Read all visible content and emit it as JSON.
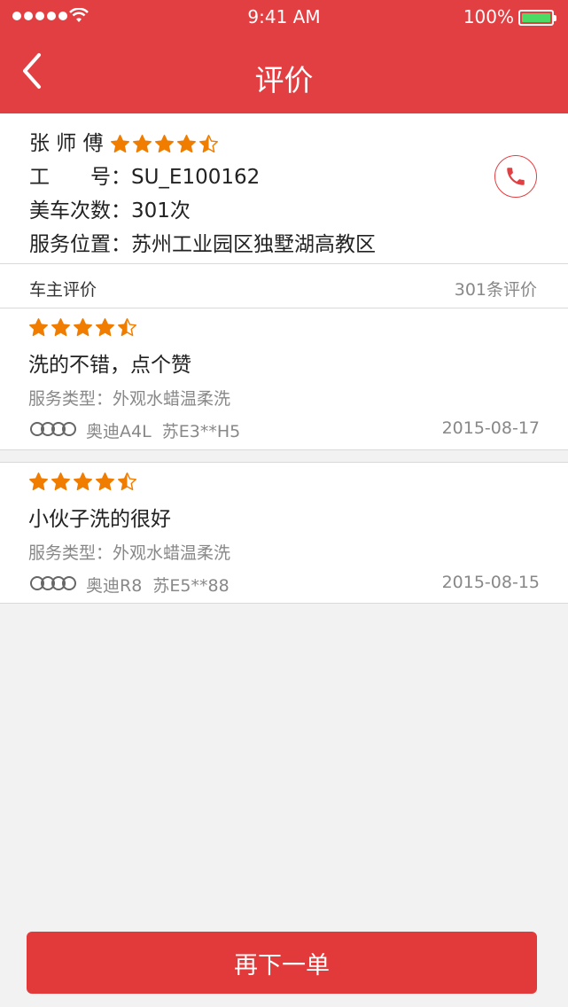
{
  "status_bar": {
    "time": "9:41 AM",
    "battery": "100%"
  },
  "header": {
    "title": "评价"
  },
  "worker": {
    "name": "张 师 傅",
    "rating": 4.5,
    "id_label": "工　　号：",
    "id_value": "SU_E100162",
    "wash_label": "美车次数：",
    "wash_value": "301次",
    "location_label": "服务位置：",
    "location_value": "苏州工业园区独墅湖高教区"
  },
  "reviews_section": {
    "title": "车主评价",
    "count": "301条评价"
  },
  "reviews": [
    {
      "rating": 4.5,
      "comment": "洗的不错，点个赞",
      "service": "服务类型：外观水蜡温柔洗",
      "car_model": "奥迪A4L",
      "plate": "苏E3**H5",
      "date": "2015-08-17"
    },
    {
      "rating": 4.5,
      "comment": "小伙子洗的很好",
      "service": "服务类型：外观水蜡温柔洗",
      "car_model": "奥迪R8",
      "plate": "苏E5**88",
      "date": "2015-08-15"
    }
  ],
  "bottom": {
    "button_label": "再下一单"
  },
  "colors": {
    "brand": "#e23f42",
    "star": "#f07d00",
    "battery": "#4cd964"
  },
  "icons": {
    "back": "chevron-left-icon",
    "call": "phone-icon",
    "star": "star-icon",
    "brand": "audi-logo"
  }
}
